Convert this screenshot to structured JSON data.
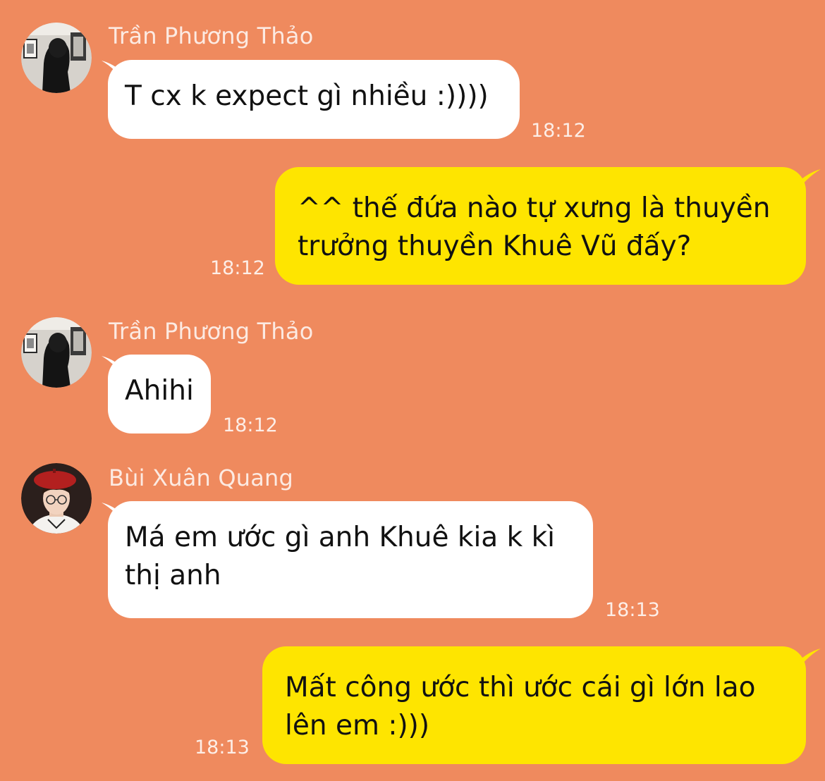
{
  "theme": {
    "background": "#EF8A5E",
    "incoming_bubble": "#FFFFFF",
    "outgoing_bubble": "#FEE500",
    "name_color": "#FCE3D6",
    "time_color": "#FCE3D6"
  },
  "messages": [
    {
      "direction": "incoming",
      "sender": "Trần Phương Thảo",
      "avatar": "gallery-photo-avatar",
      "text": "T cx k expect gì nhiều :))))",
      "time": "18:12"
    },
    {
      "direction": "outgoing",
      "text": "^^ thế đứa nào tự xưng là thuyền trưởng thuyền Khuê Vũ đấy?",
      "time": "18:12"
    },
    {
      "direction": "incoming",
      "sender": "Trần Phương Thảo",
      "avatar": "gallery-photo-avatar",
      "text": "Ahihi",
      "time": "18:12"
    },
    {
      "direction": "incoming",
      "sender": "Bùi Xuân Quang",
      "avatar": "red-beret-person-avatar",
      "text": "Má em ước gì anh Khuê kia k kì thị anh",
      "time": "18:13"
    },
    {
      "direction": "outgoing",
      "text": "Mất công ước thì ước cái gì lớn lao lên em :)))",
      "time": "18:13"
    }
  ]
}
